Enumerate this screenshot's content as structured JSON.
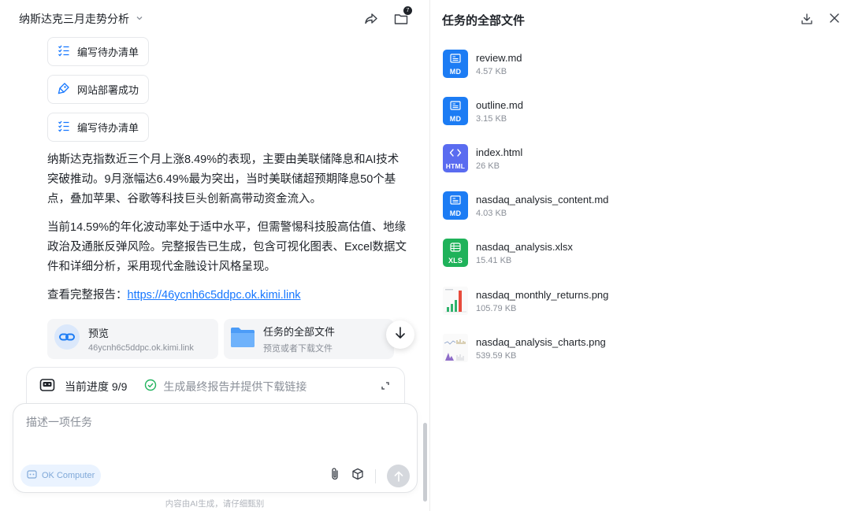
{
  "header": {
    "title": "纳斯达克三月走势分析",
    "files_badge": "7"
  },
  "chips": [
    {
      "label": "编写待办清单",
      "icon": "checklist-icon"
    },
    {
      "label": "网站部署成功",
      "icon": "deploy-icon"
    },
    {
      "label": "编写待办清单",
      "icon": "checklist-icon"
    }
  ],
  "message": {
    "p1": "纳斯达克指数近三个月上涨8.49%的表现，主要由美联储降息和AI技术突破推动。9月涨幅达6.49%最为突出，当时美联储超预期降息50个基点，叠加苹果、谷歌等科技巨头创新高带动资金流入。",
    "p2": "当前14.59%的年化波动率处于适中水平，但需警惕科技股高估值、地缘政治及通胀反弹风险。完整报告已生成，包含可视化图表、Excel数据文件和详细分析，采用现代金融设计风格呈现。",
    "p3_prefix": "查看完整报告：",
    "p3_link": "https://46ycnh6c5ddpc.ok.kimi.link"
  },
  "cards": {
    "preview": {
      "title": "预览",
      "subtitle": "46ycnh6c5ddpc.ok.kimi.link"
    },
    "files": {
      "title": "任务的全部文件",
      "subtitle": "预览或者下载文件"
    }
  },
  "progress": {
    "label": "当前进度 9/9",
    "task": "生成最终报告并提供下载链接"
  },
  "composer": {
    "placeholder": "描述一项任务",
    "mode_label": "OK Computer"
  },
  "footer_note": "内容由AI生成，请仔细甄别",
  "right_panel": {
    "title": "任务的全部文件",
    "files": [
      {
        "name": "review.md",
        "size": "4.57 KB",
        "type": "MD",
        "color": "#1c7cf4"
      },
      {
        "name": "outline.md",
        "size": "3.15 KB",
        "type": "MD",
        "color": "#1c7cf4"
      },
      {
        "name": "index.html",
        "size": "26 KB",
        "type": "HTML",
        "color": "#5a6cf0"
      },
      {
        "name": "nasdaq_analysis_content.md",
        "size": "4.03 KB",
        "type": "MD",
        "color": "#1c7cf4"
      },
      {
        "name": "nasdaq_analysis.xlsx",
        "size": "15.41 KB",
        "type": "XLS",
        "color": "#1fb25a"
      },
      {
        "name": "nasdaq_monthly_returns.png",
        "size": "105.79 KB",
        "type": "image"
      },
      {
        "name": "nasdaq_analysis_charts.png",
        "size": "539.59 KB",
        "type": "image"
      }
    ]
  }
}
